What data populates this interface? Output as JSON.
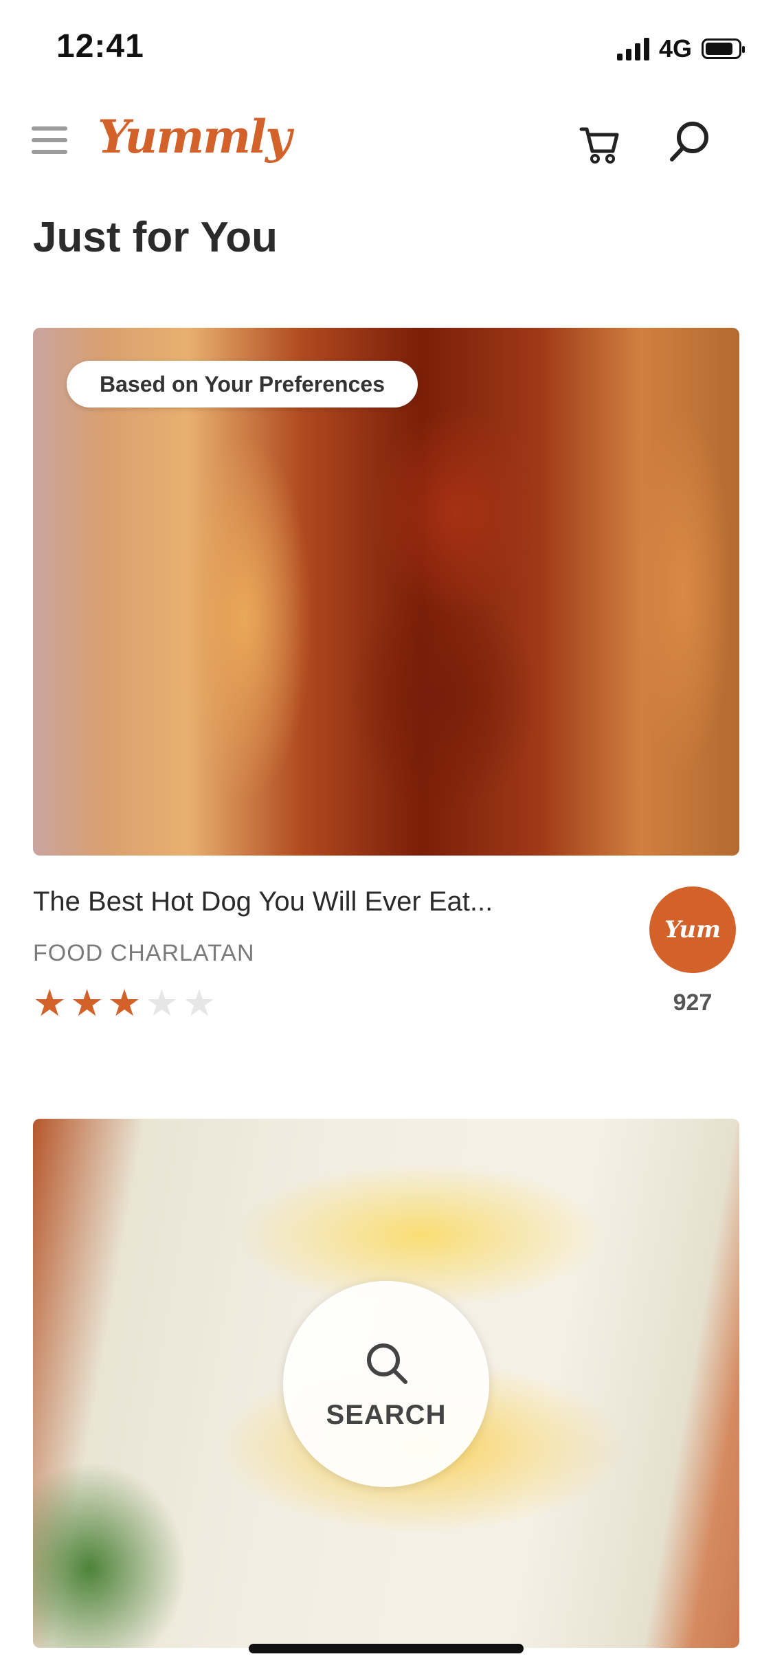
{
  "status_bar": {
    "time": "12:41",
    "network": "4G",
    "battery_level": 0.85
  },
  "header": {
    "logo": "Yummly",
    "menu_icon": "hamburger-menu-icon",
    "cart_icon": "shopping-cart-icon",
    "search_icon": "magnifier-icon"
  },
  "section": {
    "title": "Just for You"
  },
  "cards": [
    {
      "badge": "Based on Your Preferences",
      "title": "The Best Hot Dog You Will Ever Eat...",
      "source": "FOOD CHARLATAN",
      "rating": 3,
      "rating_max": 5,
      "yum_label": "Yum",
      "yum_count": "927"
    }
  ],
  "search_fab": {
    "label": "SEARCH"
  },
  "colors": {
    "brand": "#d2622a",
    "text": "#2b2b2b",
    "muted": "#7a7a7a",
    "star_off": "#e6e6e6"
  }
}
